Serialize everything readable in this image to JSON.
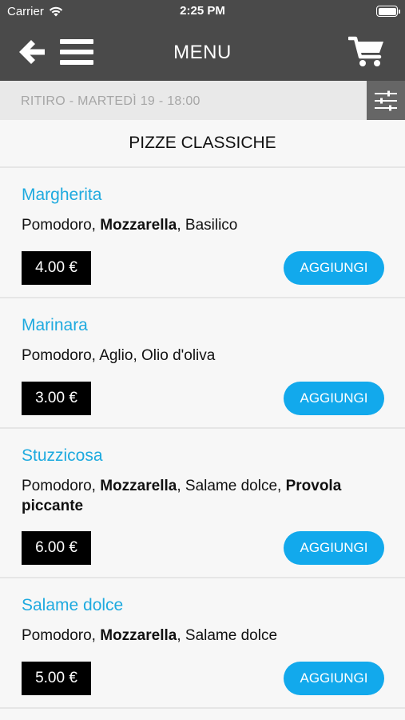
{
  "status_bar": {
    "carrier": "Carrier",
    "time": "2:25 PM"
  },
  "nav": {
    "title": "MENU",
    "back_icon": "arrow-left-icon",
    "menu_icon": "hamburger-icon",
    "cart_icon": "cart-icon"
  },
  "pickup": {
    "text": "RITIRO - MARTEDÌ 19 - 18:00",
    "filter_icon": "sliders-icon"
  },
  "section": {
    "title": "PIZZE CLASSICHE"
  },
  "colors": {
    "header": "#4a4a4a",
    "accent": "#1eaadf",
    "button": "#12a9ec",
    "price_bg": "#000000"
  },
  "items": [
    {
      "name": "Margherita",
      "ingredients": [
        {
          "text": "Pomodoro",
          "bold": false
        },
        {
          "text": "Mozzarella",
          "bold": true
        },
        {
          "text": "Basilico",
          "bold": false
        }
      ],
      "price": "4.00 €",
      "add_label": "AGGIUNGI"
    },
    {
      "name": "Marinara",
      "ingredients": [
        {
          "text": "Pomodoro",
          "bold": false
        },
        {
          "text": "Aglio",
          "bold": false
        },
        {
          "text": "Olio d'oliva",
          "bold": false
        }
      ],
      "price": "3.00 €",
      "add_label": "AGGIUNGI"
    },
    {
      "name": "Stuzzicosa",
      "ingredients": [
        {
          "text": "Pomodoro",
          "bold": false
        },
        {
          "text": "Mozzarella",
          "bold": true
        },
        {
          "text": "Salame dolce",
          "bold": false
        },
        {
          "text": "Provola piccante",
          "bold": true
        }
      ],
      "price": "6.00 €",
      "add_label": "AGGIUNGI"
    },
    {
      "name": "Salame dolce",
      "ingredients": [
        {
          "text": "Pomodoro",
          "bold": false
        },
        {
          "text": "Mozzarella",
          "bold": true
        },
        {
          "text": "Salame dolce",
          "bold": false
        }
      ],
      "price": "5.00 €",
      "add_label": "AGGIUNGI"
    }
  ]
}
